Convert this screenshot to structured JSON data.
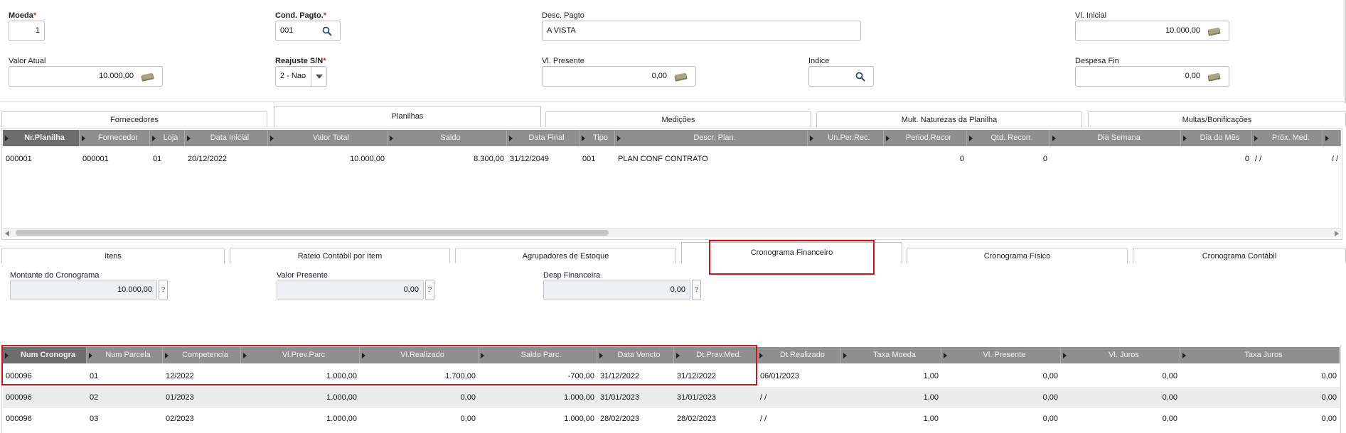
{
  "header_fields": {
    "moeda": {
      "label": "Moeda",
      "value": "1"
    },
    "cond_pagto": {
      "label": "Cond. Pagto.",
      "value": "001"
    },
    "desc_pagto": {
      "label": "Desc. Pagto",
      "value": "A VISTA"
    },
    "vl_inicial": {
      "label": "Vl. Inicial",
      "value": "10.000,00"
    },
    "valor_atual": {
      "label": "Valor Atual",
      "value": "10.000,00"
    },
    "reajuste": {
      "label": "Reajuste S/N",
      "value": "2 - Nao"
    },
    "vl_presente": {
      "label": "Vl. Presente",
      "value": "0,00"
    },
    "indice": {
      "label": "Indice",
      "value": ""
    },
    "despesa_fin": {
      "label": "Despesa Fin",
      "value": "0,00"
    },
    "required_mark": "*"
  },
  "top_tabs": [
    "Fornecedores",
    "Planilhas",
    "Medições",
    "Mult. Naturezas da Planilha",
    "Multas/Bonificações"
  ],
  "planilhas_grid": {
    "columns": [
      "Nr.Planilha",
      "Fornecedor",
      "Loja",
      "Data Inicial",
      "Valor Total",
      "Saldo",
      "Data Final",
      "Tipo",
      "Descr. Plan.",
      "Un.Per.Rec.",
      "Period.Recor",
      "Qtd. Recorr.",
      "Dia Semana",
      "Dia do Mês",
      "Próx. Med.",
      ""
    ],
    "rows": [
      [
        "000001",
        "000001",
        "01",
        "20/12/2022",
        "10.000,00",
        "8.300,00",
        "31/12/2049",
        "001",
        "PLAN CONF CONTRATO",
        "",
        "0",
        "0",
        "",
        "0",
        " /  /",
        " /  /"
      ]
    ]
  },
  "bottom_tabs": [
    "Itens",
    "Rateio Contábil por Item",
    "Agrupadores de Estoque",
    "Cronograma Financeiro",
    "Cronograma Físico",
    "Cronograma Contábil"
  ],
  "cronograma_fields": {
    "montante": {
      "label": "Montante do Cronograma",
      "value": "10.000,00"
    },
    "valor_presente": {
      "label": "Valor Presente",
      "value": "0,00"
    },
    "desp_financeira": {
      "label": "Desp Financeira",
      "value": "0,00"
    },
    "help_glyph": "?"
  },
  "cronograma_grid": {
    "columns": [
      "Num Cronogra",
      "Num Parcela",
      "Competencia",
      "Vl.Prev.Parc",
      "Vl.Realizado",
      "Saldo Parc.",
      "Data Vencto",
      "Dt.Prev.Med.",
      "Dt.Realizado",
      "Taxa Moeda",
      "Vl. Presente",
      "Vl. Juros",
      "Taxa Juros"
    ],
    "rows": [
      [
        "000096",
        "01",
        "12/2022",
        "1.000,00",
        "1.700,00",
        "-700,00",
        "31/12/2022",
        "31/12/2022",
        "06/01/2023",
        "1,00",
        "0,00",
        "0,00",
        "0,00"
      ],
      [
        "000096",
        "02",
        "01/2023",
        "1.000,00",
        "0,00",
        "1.000,00",
        "31/01/2023",
        "31/01/2023",
        " /  /",
        "1,00",
        "0,00",
        "0,00",
        "0,00"
      ],
      [
        "000096",
        "03",
        "02/2023",
        "1.000,00",
        "0,00",
        "1.000,00",
        "28/02/2023",
        "28/02/2023",
        " /  /",
        "1,00",
        "0,00",
        "0,00",
        "0,00"
      ]
    ]
  },
  "reajuste_dropdown_icon": "chevron-down-icon"
}
